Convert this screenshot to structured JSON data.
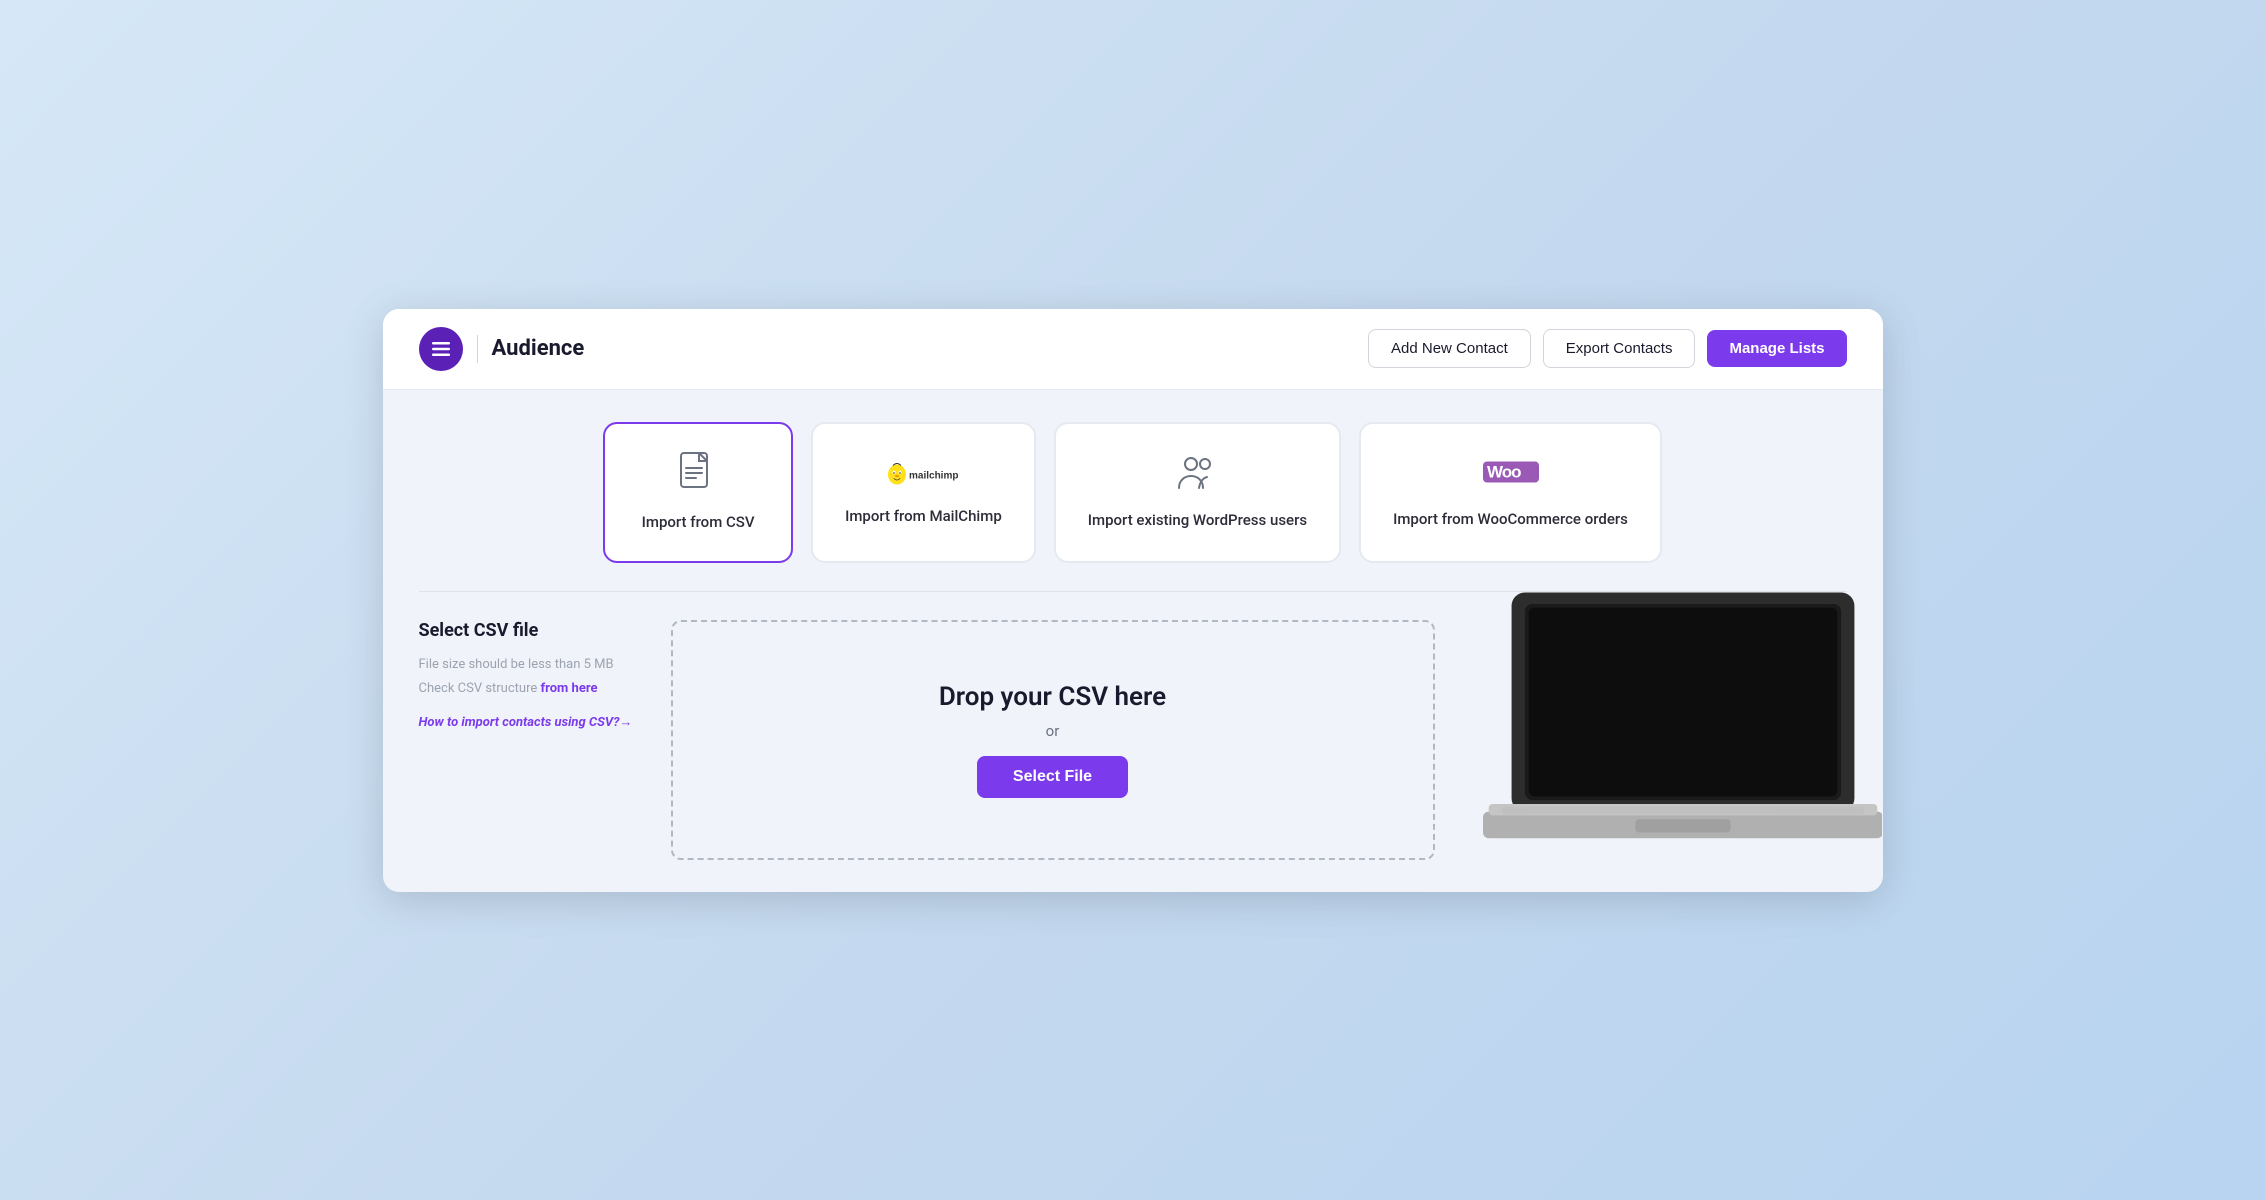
{
  "header": {
    "title": "Audience",
    "add_contact_label": "Add New Contact",
    "export_contacts_label": "Export Contacts",
    "manage_lists_label": "Manage Lists"
  },
  "import_methods": [
    {
      "id": "csv",
      "label": "Import from CSV",
      "icon_type": "csv",
      "active": true
    },
    {
      "id": "mailchimp",
      "label": "Import from MailChimp",
      "icon_type": "mailchimp",
      "active": false
    },
    {
      "id": "wordpress",
      "label": "Import existing WordPress users",
      "icon_type": "users",
      "active": false
    },
    {
      "id": "woocommerce",
      "label": "Import from WooCommerce orders",
      "icon_type": "woo",
      "active": false
    }
  ],
  "csv_section": {
    "title": "Select CSV file",
    "file_size_note": "File size should be less than 5 MB",
    "check_structure_text": "Check CSV structure",
    "from_here_link": "from here",
    "how_to_link": "How to import contacts using CSV?",
    "how_to_arrow": "→"
  },
  "dropzone": {
    "drop_text": "Drop your CSV here",
    "or_text": "or",
    "select_file_label": "Select File"
  },
  "colors": {
    "primary": "#7c3aed",
    "primary_dark": "#6d28d9"
  }
}
